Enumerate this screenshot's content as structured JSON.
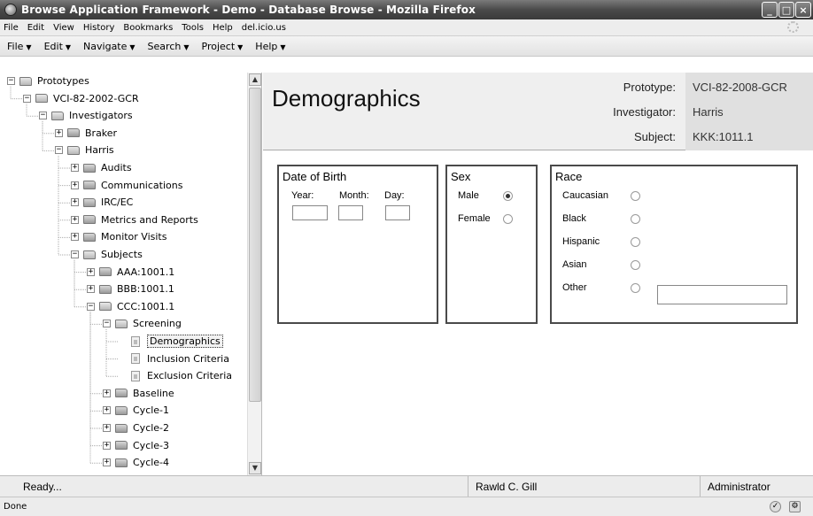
{
  "window": {
    "title": "Browse Application Framework - Demo - Database Browse - Mozilla Firefox",
    "minimize": "_",
    "maximize": "□",
    "close": "×"
  },
  "browser_menu": [
    "File",
    "Edit",
    "View",
    "History",
    "Bookmarks",
    "Tools",
    "Help",
    "del.icio.us"
  ],
  "app_menu": [
    "File",
    "Edit",
    "Navigate",
    "Search",
    "Project",
    "Help"
  ],
  "tree": [
    {
      "label": "Prototypes",
      "depth": 0,
      "toggle": "−",
      "icon": "folder-open"
    },
    {
      "label": "VCI-82-2002-GCR",
      "depth": 1,
      "toggle": "−",
      "icon": "folder-open"
    },
    {
      "label": "Investigators",
      "depth": 2,
      "toggle": "−",
      "icon": "folder-open"
    },
    {
      "label": "Braker",
      "depth": 3,
      "toggle": "+",
      "icon": "folder"
    },
    {
      "label": "Harris",
      "depth": 3,
      "toggle": "−",
      "icon": "folder-open"
    },
    {
      "label": "Audits",
      "depth": 4,
      "toggle": "+",
      "icon": "folder"
    },
    {
      "label": "Communications",
      "depth": 4,
      "toggle": "+",
      "icon": "folder"
    },
    {
      "label": "IRC/EC",
      "depth": 4,
      "toggle": "+",
      "icon": "folder"
    },
    {
      "label": "Metrics and Reports",
      "depth": 4,
      "toggle": "+",
      "icon": "folder"
    },
    {
      "label": "Monitor Visits",
      "depth": 4,
      "toggle": "+",
      "icon": "folder"
    },
    {
      "label": "Subjects",
      "depth": 4,
      "toggle": "−",
      "icon": "folder-open"
    },
    {
      "label": "AAA:1001.1",
      "depth": 5,
      "toggle": "+",
      "icon": "folder"
    },
    {
      "label": "BBB:1001.1",
      "depth": 5,
      "toggle": "+",
      "icon": "folder"
    },
    {
      "label": "CCC:1001.1",
      "depth": 5,
      "toggle": "−",
      "icon": "folder-open"
    },
    {
      "label": "Screening",
      "depth": 6,
      "toggle": "−",
      "icon": "folder-open"
    },
    {
      "label": "Demographics",
      "depth": 7,
      "toggle": "",
      "icon": "document",
      "selected": true
    },
    {
      "label": "Inclusion Criteria",
      "depth": 7,
      "toggle": "",
      "icon": "document"
    },
    {
      "label": "Exclusion Criteria",
      "depth": 7,
      "toggle": "",
      "icon": "document"
    },
    {
      "label": "Baseline",
      "depth": 6,
      "toggle": "+",
      "icon": "folder"
    },
    {
      "label": "Cycle-1",
      "depth": 6,
      "toggle": "+",
      "icon": "folder"
    },
    {
      "label": "Cycle-2",
      "depth": 6,
      "toggle": "+",
      "icon": "folder"
    },
    {
      "label": "Cycle-3",
      "depth": 6,
      "toggle": "+",
      "icon": "folder"
    },
    {
      "label": "Cycle-4",
      "depth": 6,
      "toggle": "+",
      "icon": "folder"
    }
  ],
  "page": {
    "title": "Demographics",
    "prototype_label": "Prototype:",
    "prototype_value": "VCI-82-2008-GCR",
    "investigator_label": "Investigator:",
    "investigator_value": "Harris",
    "subject_label": "Subject:",
    "subject_value": "KKK:1011.1"
  },
  "dob": {
    "title": "Date of Birth",
    "year_label": "Year:",
    "month_label": "Month:",
    "day_label": "Day:",
    "year": "",
    "month": "",
    "day": ""
  },
  "sex": {
    "title": "Sex",
    "options": [
      "Male",
      "Female"
    ],
    "selected": "Male"
  },
  "race": {
    "title": "Race",
    "options": [
      "Caucasian",
      "Black",
      "Hispanic",
      "Asian",
      "Other"
    ],
    "selected": "",
    "other_text": ""
  },
  "status": {
    "message": "Ready...",
    "user": "Rawld C. Gill",
    "role": "Administrator"
  },
  "browser_status": "Done"
}
